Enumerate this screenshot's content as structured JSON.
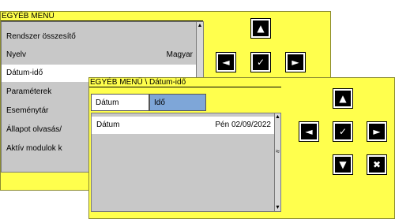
{
  "back_window": {
    "title": "EGYÉB MENÜ",
    "items": [
      {
        "label": "Rendszer összesítő",
        "value": ""
      },
      {
        "label": "Nyelv",
        "value": "Magyar"
      },
      {
        "label": "Dátum-idő",
        "value": ""
      },
      {
        "label": "Paraméterek",
        "value": ""
      },
      {
        "label": "Eseménytár",
        "value": ""
      },
      {
        "label": "Állapot olvasás/",
        "value": ""
      },
      {
        "label": "Aktív modulok k",
        "value": ""
      }
    ],
    "selected_index": 2,
    "buttons": {
      "up": "▲",
      "left": "◄",
      "ok": "✓",
      "right": "►"
    }
  },
  "front_window": {
    "title": "EGYÉB MENÜ \\ Dátum-idő",
    "tabs": [
      {
        "label": "Dátum",
        "active": false
      },
      {
        "label": "Idő",
        "active": true
      }
    ],
    "items": [
      {
        "label": "Dátum",
        "value": "Pén 02/09/2022"
      }
    ],
    "buttons": {
      "up": "▲",
      "left": "◄",
      "ok": "✓",
      "right": "►",
      "down": "▼",
      "cancel": "✖"
    }
  },
  "colors": {
    "panel_bg": "#ffff4d",
    "list_bg": "#c8c8c8",
    "active_tab": "#7ea6d8",
    "button_bg": "#000000"
  },
  "icons": {
    "up": "arrow-up-icon",
    "down": "arrow-down-icon",
    "left": "arrow-left-icon",
    "right": "arrow-right-icon",
    "ok": "checkmark-icon",
    "cancel": "cancel-x-icon"
  }
}
